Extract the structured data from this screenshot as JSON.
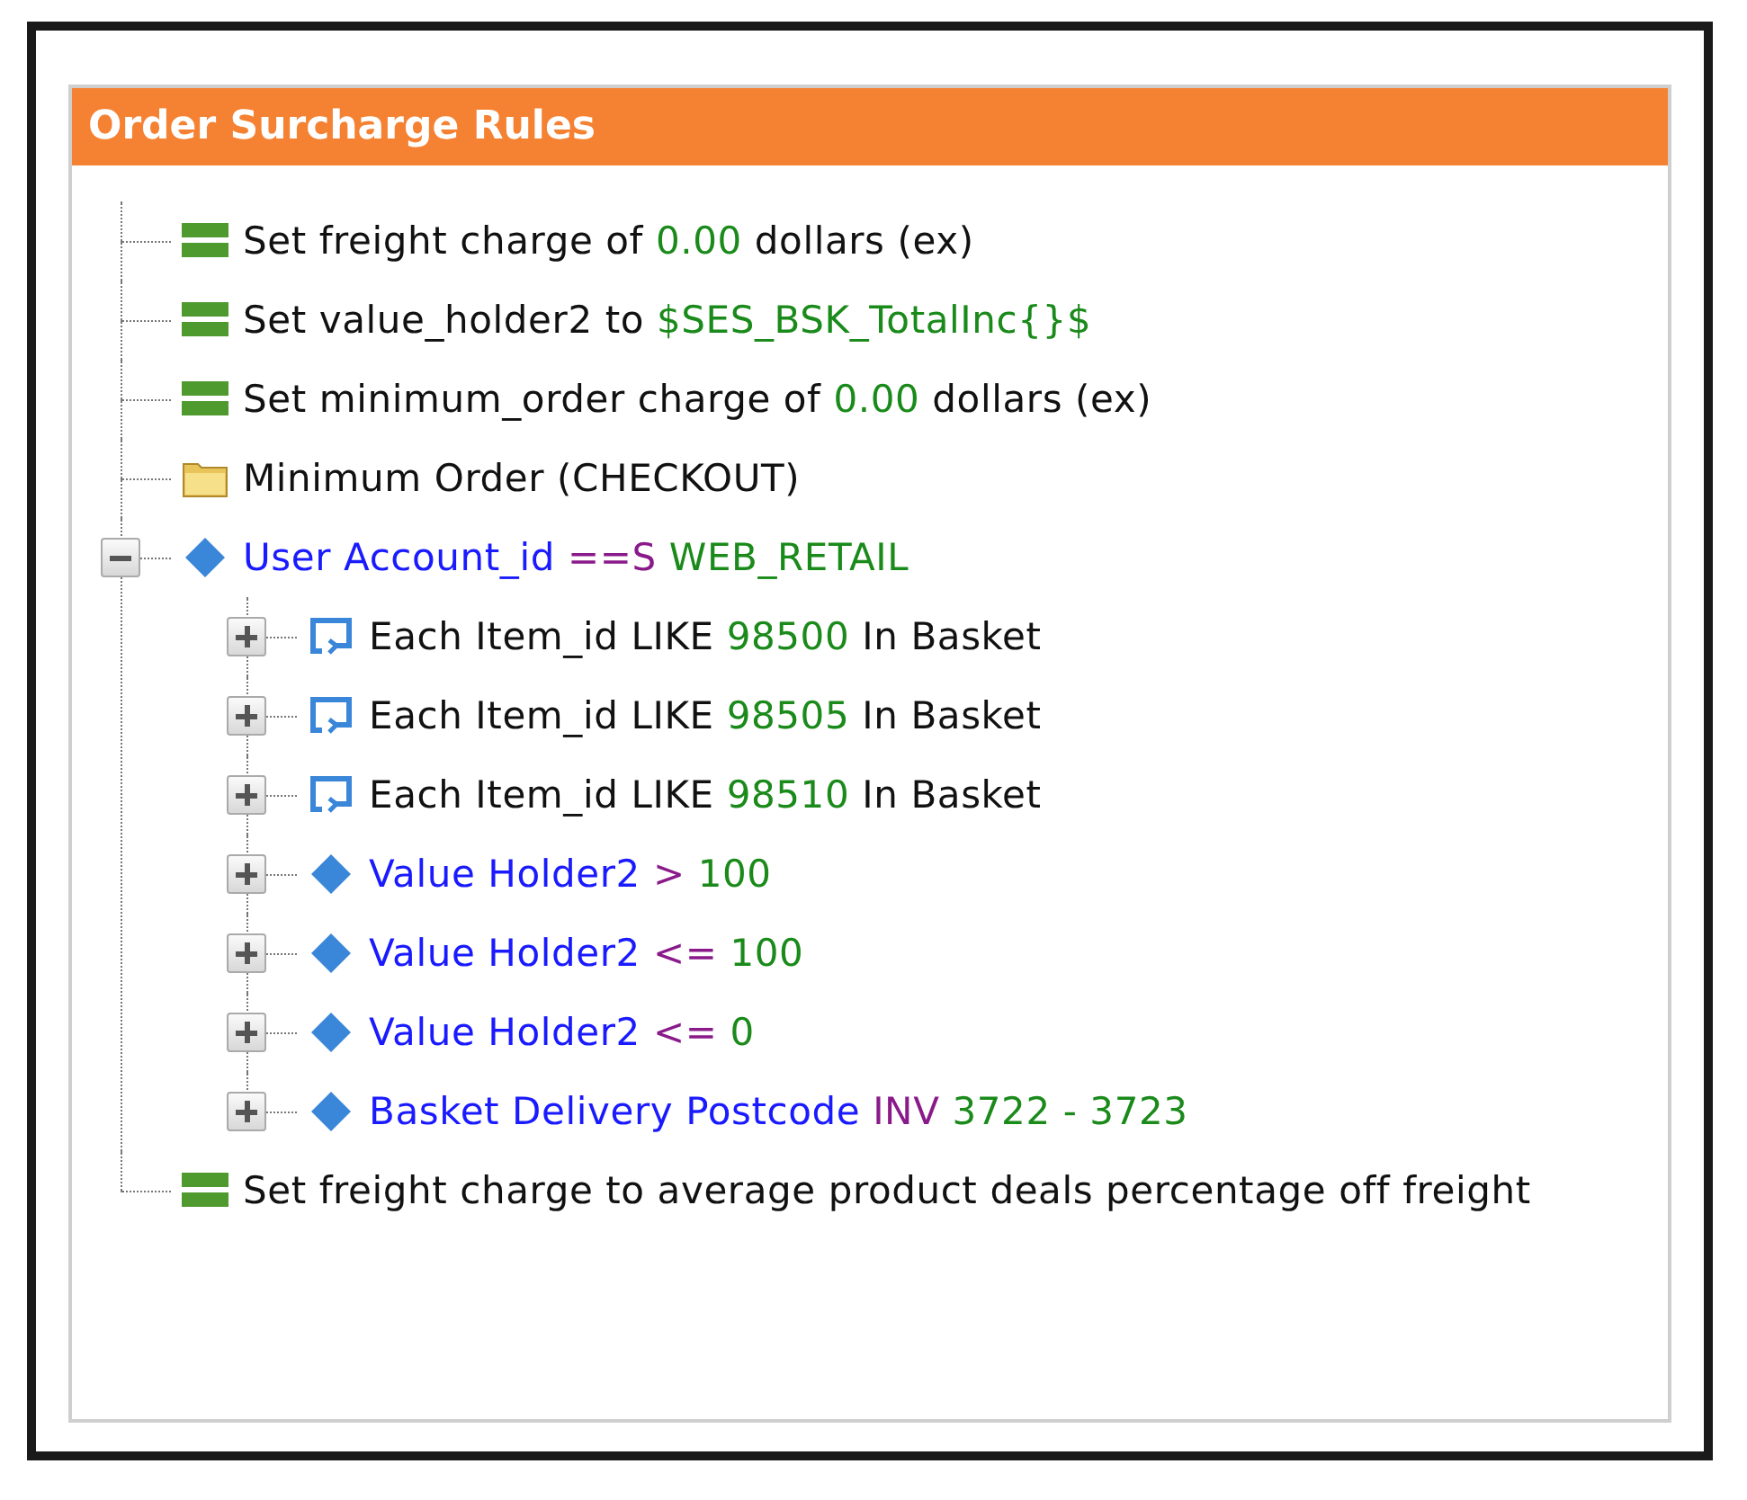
{
  "panel": {
    "title": "Order Surcharge Rules"
  },
  "tree": [
    {
      "kind": "action",
      "parts": [
        {
          "kind": "plain",
          "text": "Set freight charge of "
        },
        {
          "kind": "value",
          "text": "0.00"
        },
        {
          "kind": "plain",
          "text": " dollars (ex)"
        }
      ]
    },
    {
      "kind": "action",
      "parts": [
        {
          "kind": "plain",
          "text": "Set value_holder2 to "
        },
        {
          "kind": "value",
          "text": "$SES_BSK_TotalInc{}$"
        }
      ]
    },
    {
      "kind": "action",
      "parts": [
        {
          "kind": "plain",
          "text": "Set minimum_order charge of "
        },
        {
          "kind": "value",
          "text": "0.00"
        },
        {
          "kind": "plain",
          "text": " dollars (ex)"
        }
      ]
    },
    {
      "kind": "folder",
      "parts": [
        {
          "kind": "plain",
          "text": "Minimum Order (CHECKOUT)"
        }
      ]
    },
    {
      "kind": "condition",
      "expanded": true,
      "parts": [
        {
          "kind": "field",
          "text": "User Account_id "
        },
        {
          "kind": "op",
          "text": "==S"
        },
        {
          "kind": "value",
          "text": " WEB_RETAIL"
        }
      ],
      "children": [
        {
          "kind": "loop",
          "expanded": false,
          "parts": [
            {
              "kind": "plain",
              "text": "Each Item_id LIKE "
            },
            {
              "kind": "value",
              "text": "98500"
            },
            {
              "kind": "plain",
              "text": " In Basket"
            }
          ]
        },
        {
          "kind": "loop",
          "expanded": false,
          "parts": [
            {
              "kind": "plain",
              "text": "Each Item_id LIKE "
            },
            {
              "kind": "value",
              "text": "98505"
            },
            {
              "kind": "plain",
              "text": " In Basket"
            }
          ]
        },
        {
          "kind": "loop",
          "expanded": false,
          "parts": [
            {
              "kind": "plain",
              "text": "Each Item_id LIKE "
            },
            {
              "kind": "value",
              "text": "98510"
            },
            {
              "kind": "plain",
              "text": " In Basket"
            }
          ]
        },
        {
          "kind": "condition",
          "expanded": false,
          "parts": [
            {
              "kind": "field",
              "text": "Value Holder2 "
            },
            {
              "kind": "op",
              "text": ">"
            },
            {
              "kind": "value",
              "text": " 100"
            }
          ]
        },
        {
          "kind": "condition",
          "expanded": false,
          "parts": [
            {
              "kind": "field",
              "text": "Value Holder2 "
            },
            {
              "kind": "op",
              "text": "<="
            },
            {
              "kind": "value",
              "text": " 100"
            }
          ]
        },
        {
          "kind": "condition",
          "expanded": false,
          "parts": [
            {
              "kind": "field",
              "text": "Value Holder2 "
            },
            {
              "kind": "op",
              "text": "<="
            },
            {
              "kind": "value",
              "text": " 0"
            }
          ]
        },
        {
          "kind": "condition",
          "expanded": false,
          "parts": [
            {
              "kind": "field",
              "text": "Basket Delivery Postcode "
            },
            {
              "kind": "op",
              "text": "INV"
            },
            {
              "kind": "value",
              "text": " 3722 - 3723"
            }
          ]
        }
      ]
    },
    {
      "kind": "action",
      "parts": [
        {
          "kind": "plain",
          "text": "Set freight charge to average product deals percentage off freight"
        }
      ]
    }
  ]
}
